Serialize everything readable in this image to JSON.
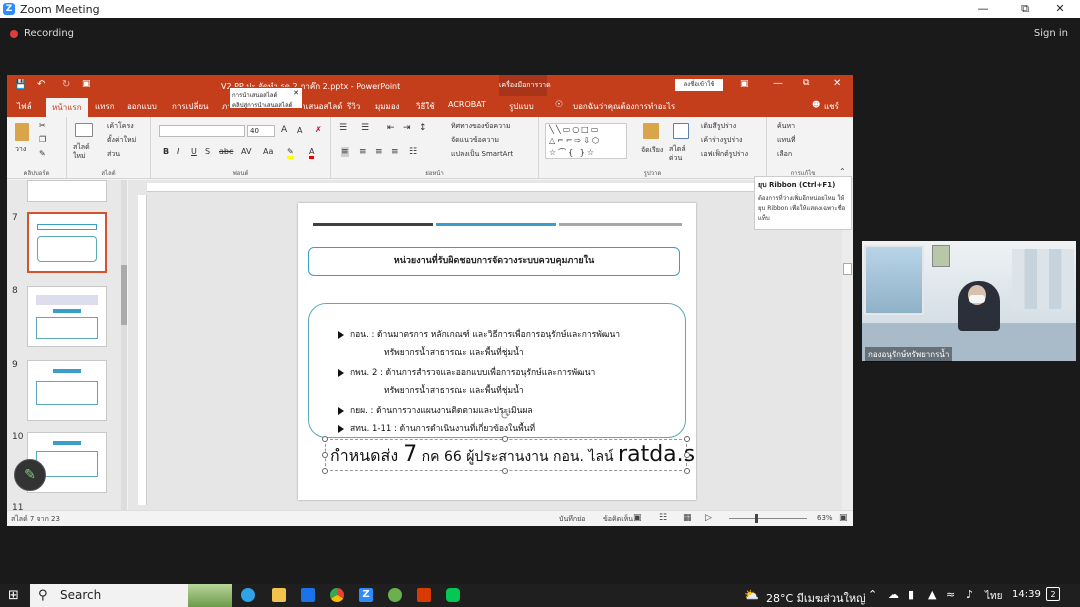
{
  "zoom": {
    "title": "Zoom Meeting",
    "recording": "Recording",
    "sign_in": "Sign in",
    "participant_name": "กองอนุรักษ์ทรัพยากรน้ำ"
  },
  "ppt": {
    "title": "V2 PP ปะ จัดทำ รด 2 ภาค๊ก 2.pptx - PowerPoint",
    "tool_context": "เครื่องมือการวาด",
    "signin_button": "ลงชื่อเข้าใช้",
    "tabs": [
      "ไฟล์",
      "หน้าแรก",
      "แทรก",
      "ออกแบบ",
      "การเปลี่ยน",
      "ภาพเคลื่อนไหว",
      "การนำเสนอสไลด์",
      "รีวิว",
      "มุมมอง",
      "วิธีใช้",
      "ACROBAT",
      "รูปแบบ"
    ],
    "search_tell": "บอกฉันว่าคุณต้องการทำอะไร",
    "share": "แชร์",
    "groups": {
      "clipboard": "คลิปบอร์ด",
      "slides": "สไลด์",
      "font": "ฟอนต์",
      "paragraph": "ย่อหน้า",
      "drawing": "รูปวาด",
      "editing": "การแก้ไข"
    },
    "ribbon": {
      "paste": "วาง",
      "new_slide": "สไลด์ใหม่",
      "layout": "เค้าโครง",
      "reset": "ตั้งค่าใหม่",
      "section": "ส่วน",
      "font_size": "40",
      "text_direction": "ทิศทางของข้อความ",
      "align_text": "จัดแนวข้อความ",
      "smartart": "แปลงเป็น SmartArt",
      "arrange": "จัดเรียง",
      "quick_styles": "สไตล์ด่วน",
      "shape_fill": "เติมสีรูปร่าง",
      "shape_outline": "เค้าร่างรูปร่าง",
      "shape_effects": "เอฟเฟ็กต์รูปร่าง",
      "find": "ค้นหา",
      "replace": "แทนที่",
      "select": "เลือก"
    },
    "paste_tip": {
      "line1": "การนำเสนอสไลด์",
      "line2": "คลิปสู่การนำเสนอสไลด์"
    },
    "ribbon_tip": {
      "title": "ยุบ Ribbon (Ctrl+F1)",
      "body": "ต้องการที่ว่างเพิ่มอีกหน่อยไหม ให้ยุบ Ribbon เพื่อให้แสดงเฉพาะชื่อแท็บ"
    },
    "thumb_numbers": [
      "7",
      "8",
      "9",
      "10",
      "11"
    ],
    "status": {
      "slide_count": "สไลด์ 7 จาก 23",
      "notes": "บันทึกย่อ",
      "comments": "ข้อคิดเห็น",
      "zoom": "63%"
    }
  },
  "slide": {
    "heading": "หน่วยงานที่รับผิดชอบการจัดวางระบบควบคุมภายใน",
    "bullets": [
      {
        "text": "กอน.  : ด้านมาตรการ หลักเกณฑ์ และวิธีการเพื่อการอนุรักษ์และการพัฒนา",
        "cont": "ทรัพยากรน้ำสาธารณะ และพื้นที่ชุ่มน้ำ"
      },
      {
        "text": "กพน. 2 : ด้านการสำรวจและออกแบบเพื่อการอนุรักษ์และการพัฒนา",
        "cont": "ทรัพยากรน้ำสาธารณะ และพื้นที่ชุ่มน้ำ"
      },
      {
        "text": "กยผ. :      ด้านการวางแผนงานติดตามและประเมินผล",
        "cont": ""
      },
      {
        "text": "สทน. 1-11 : ด้านการดำเนินงานที่เกี่ยวข้องในพื้นที่",
        "cont": ""
      }
    ],
    "note_prefix": "กำหนดส่ง ",
    "note_big": "7",
    "note_mid": " กค 66  ผู้ประสานงาน กอน. ไลน์ ",
    "note_end": "ratda.s"
  },
  "taskbar": {
    "search": "Search",
    "weather": "28°C  มีเมฆส่วนใหญ่",
    "lang": "ไทย",
    "time": "14:39"
  },
  "colors": {
    "ppt_accent": "#c43e1c",
    "slide_teal": "#3a9fc8",
    "slide_bar_dark": "#404040",
    "slide_bar_gray": "#a6a6a6"
  }
}
